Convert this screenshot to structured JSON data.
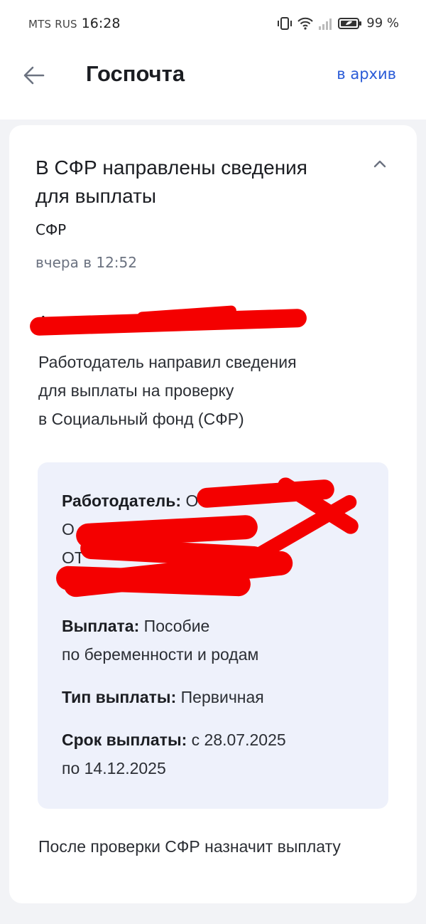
{
  "status_bar": {
    "carrier": "MTS RUS",
    "time": "16:28",
    "battery": "99 %"
  },
  "nav": {
    "title": "Госпочта",
    "archive": "в архив"
  },
  "message": {
    "title": "В СФР направлены сведения для выплаты",
    "sender": "СФР",
    "date": "вчера в 12:52",
    "recipient": "А",
    "body": [
      "Работодатель направил сведения",
      "для выплаты на проверку",
      "в Социальный фонд (СФР)"
    ],
    "details": {
      "employer_label": "Работодатель:",
      "employer_value": "О",
      "employer_line2": "О",
      "employer_line3": "ОТ",
      "payment_label": "Выплата:",
      "payment_value": "Пособие",
      "payment_line2": "по беременности и родам",
      "type_label": "Тип выплаты:",
      "type_value": "Первичная",
      "term_label": "Срок выплаты:",
      "term_value": "с 28.07.2025",
      "term_line2": "по 14.12.2025"
    },
    "footer": "После проверки СФР назначит выплату"
  },
  "colors": {
    "accent": "#2a5bd7",
    "redaction": "#f40000",
    "info_bg": "#eef1fb"
  }
}
